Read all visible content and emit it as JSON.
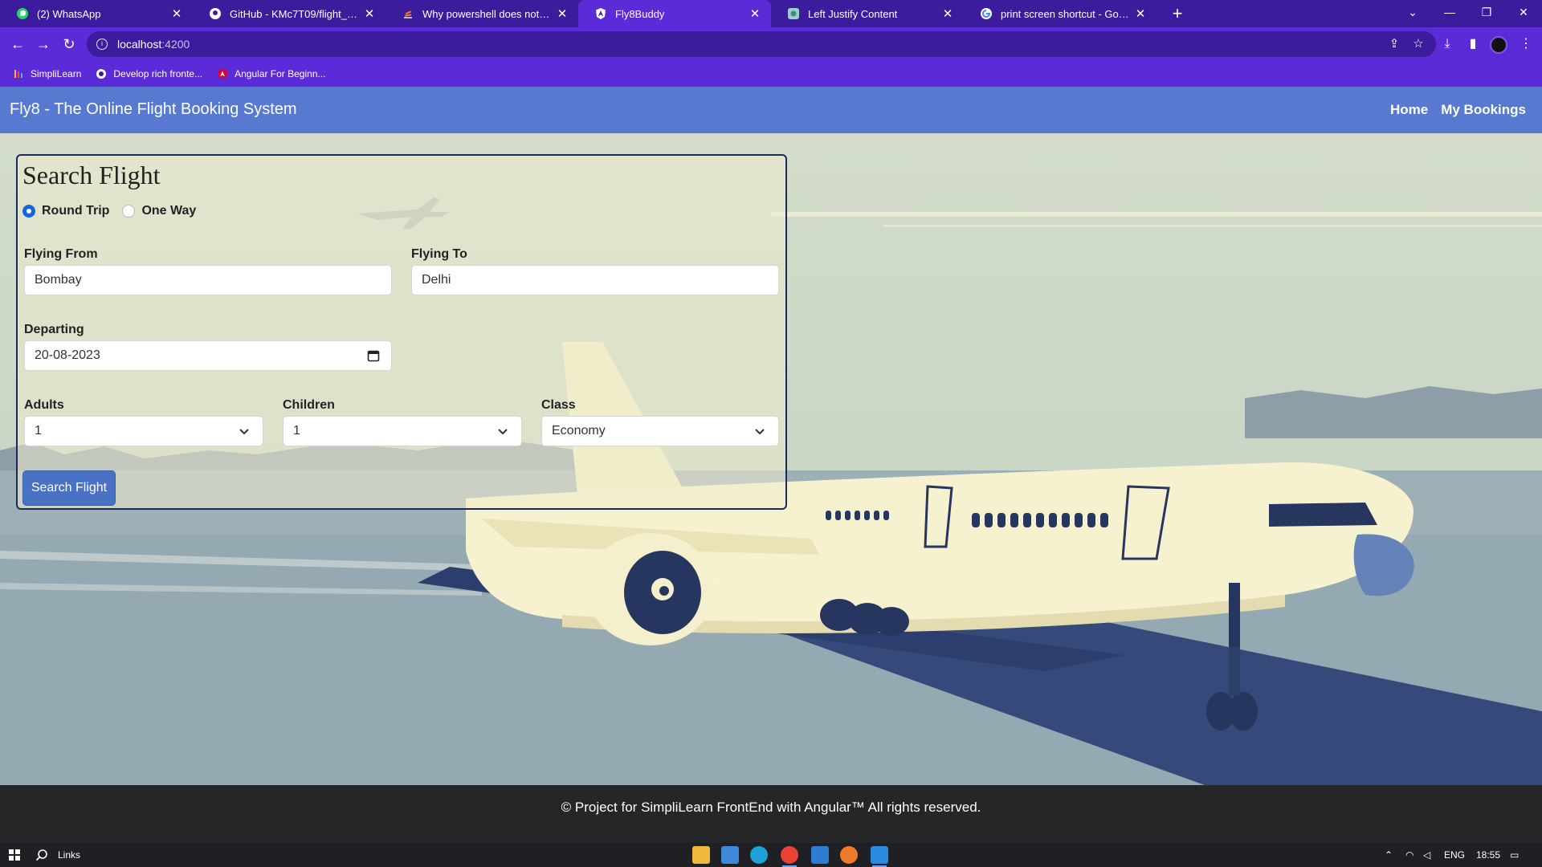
{
  "browser": {
    "tabs": [
      {
        "title": "(2) WhatsApp",
        "icon": "whatsapp-icon",
        "active": false
      },
      {
        "title": "GitHub - KMc7T09/flight_reservat",
        "icon": "github-icon",
        "active": false
      },
      {
        "title": "Why powershell does not run Ang",
        "icon": "stackoverflow-icon",
        "active": false
      },
      {
        "title": "Fly8Buddy",
        "icon": "angular-icon",
        "active": true
      },
      {
        "title": "Left Justify Content",
        "icon": "bookmark-site-icon",
        "active": false
      },
      {
        "title": "print screen shortcut - Google Se",
        "icon": "google-icon",
        "active": false
      }
    ],
    "url_host": "localhost",
    "url_port": ":4200",
    "bookmarks": [
      {
        "label": "SimpliLearn",
        "icon": "simplilearn-icon"
      },
      {
        "label": "Develop rich fronte...",
        "icon": "globe-icon"
      },
      {
        "label": "Angular For Beginn...",
        "icon": "angular-icon"
      }
    ]
  },
  "app": {
    "brand": "Fly8 - The Online Flight Booking System",
    "nav": {
      "home": "Home",
      "bookings": "My Bookings"
    },
    "colors": {
      "navbar": "#5779cf",
      "button": "#4a72c4",
      "footer": "#252628",
      "card_border": "#1a2a5a"
    }
  },
  "search": {
    "title": "Search Flight",
    "trip_types": {
      "round": "Round Trip",
      "oneway": "One Way",
      "selected": "Round Trip"
    },
    "from": {
      "label": "Flying From",
      "value": "Bombay"
    },
    "to": {
      "label": "Flying To",
      "value": "Delhi"
    },
    "departing": {
      "label": "Departing",
      "value": "20-08-2023"
    },
    "adults": {
      "label": "Adults",
      "value": "1"
    },
    "children": {
      "label": "Children",
      "value": "1"
    },
    "class": {
      "label": "Class",
      "value": "Economy"
    },
    "submit": "Search Flight"
  },
  "footer": {
    "text": "© Project for SimpliLearn FrontEnd with Angular™ All rights reserved."
  },
  "taskbar": {
    "search": "Links",
    "lang": "ENG",
    "time": "18:55"
  }
}
